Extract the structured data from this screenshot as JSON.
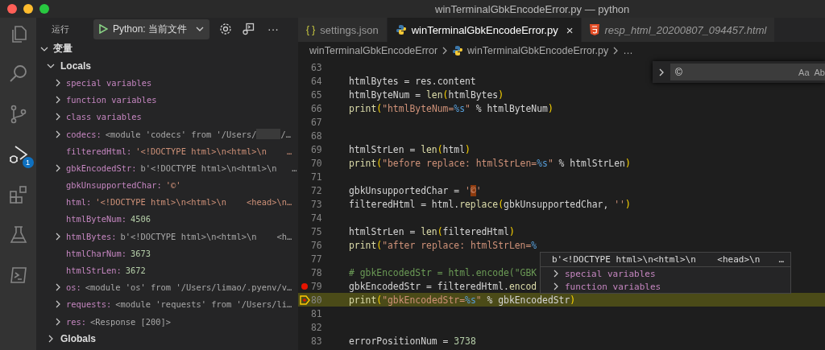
{
  "window": {
    "title": "winTerminalGbkEncodeError.py — python"
  },
  "activity_bar": [
    {
      "kind": "files",
      "selected": false
    },
    {
      "kind": "search",
      "selected": false
    },
    {
      "kind": "source-control",
      "selected": false
    },
    {
      "kind": "debug",
      "selected": true,
      "badge": "1"
    },
    {
      "kind": "extensions",
      "selected": false
    },
    {
      "kind": "testing",
      "selected": false
    },
    {
      "kind": "remote",
      "selected": false
    }
  ],
  "sidebar": {
    "title": "运行",
    "launch_config": "Python: 当前文件",
    "more": "···",
    "variables": {
      "label": "变量",
      "expanded": true,
      "scopes": [
        {
          "label": "Locals",
          "expanded": true,
          "items": [
            {
              "name": "special variables",
              "expandable": true
            },
            {
              "name": "function variables",
              "expandable": true
            },
            {
              "name": "class variables",
              "expandable": true
            },
            {
              "name": "codecs:",
              "value": "<module 'codecs' from '/Users/",
              "kind": "obj",
              "redacted": true,
              "value_tail": "/…",
              "expandable": true
            },
            {
              "name": "filteredHtml:",
              "value": "'<!DOCTYPE html>\\n<html>\\n    …",
              "kind": "str",
              "expandable": false
            },
            {
              "name": "gbkEncodedStr:",
              "value": "b'<!DOCTYPE html>\\n<html>\\n   …",
              "kind": "obj",
              "expandable": true
            },
            {
              "name": "gbkUnsupportedChar:",
              "value": "'©'",
              "kind": "str",
              "expandable": false
            },
            {
              "name": "html:",
              "value": "'<!DOCTYPE html>\\n<html>\\n    <head>\\n…",
              "kind": "str",
              "expandable": false
            },
            {
              "name": "htmlByteNum:",
              "value": "4506",
              "kind": "num",
              "expandable": false
            },
            {
              "name": "htmlBytes:",
              "value": "b'<!DOCTYPE html>\\n<html>\\n    <h…",
              "kind": "obj",
              "expandable": true
            },
            {
              "name": "htmlCharNum:",
              "value": "3673",
              "kind": "num",
              "expandable": false
            },
            {
              "name": "htmlStrLen:",
              "value": "3672",
              "kind": "num",
              "expandable": false
            },
            {
              "name": "os:",
              "value": "<module 'os' from '/Users/limao/.pyenv/v…",
              "kind": "obj",
              "expandable": true
            },
            {
              "name": "requests:",
              "value": "<module 'requests' from '/Users/li…",
              "kind": "obj",
              "expandable": true
            },
            {
              "name": "res:",
              "value": "<Response [200]>",
              "kind": "obj",
              "expandable": true
            }
          ]
        },
        {
          "label": "Globals",
          "expanded": false
        }
      ]
    }
  },
  "tabs": [
    {
      "label": "settings.json",
      "kind": "json",
      "icon_text": "{ }",
      "selected": false,
      "preview": false
    },
    {
      "label": "winTerminalGbkEncodeError.py",
      "kind": "python",
      "selected": true,
      "preview": false,
      "close": "×"
    },
    {
      "label": "resp_html_20200807_094457.html",
      "kind": "html",
      "selected": false,
      "preview": true
    }
  ],
  "breadcrumbs": [
    {
      "label": "winTerminalGbkEncodeError",
      "kind": "folder"
    },
    {
      "label": "winTerminalGbkEncodeError.py",
      "kind": "python"
    },
    {
      "label": "…",
      "kind": "more"
    }
  ],
  "find_widget": {
    "value": "©",
    "options": [
      "Aa",
      "Ab"
    ]
  },
  "code": [
    {
      "number": "63"
    },
    {
      "number": "64",
      "tokens": [
        {
          "text": "htmlBytes = res.content",
          "kind": "plain"
        }
      ]
    },
    {
      "number": "65",
      "tokens": [
        {
          "text": "htmlByteNum = ",
          "kind": "plain"
        },
        {
          "text": "len",
          "kind": "function"
        },
        {
          "text": "(",
          "kind": "paren"
        },
        {
          "text": "htmlBytes",
          "kind": "plain"
        },
        {
          "text": ")",
          "kind": "paren"
        }
      ]
    },
    {
      "number": "66",
      "tokens": [
        {
          "text": "print",
          "kind": "function"
        },
        {
          "text": "(",
          "kind": "paren"
        },
        {
          "text": "\"htmlByteNum=",
          "kind": "string"
        },
        {
          "text": "%s",
          "kind": "format"
        },
        {
          "text": "\"",
          "kind": "string"
        },
        {
          "text": " % htmlByteNum",
          "kind": "plain"
        },
        {
          "text": ")",
          "kind": "paren"
        }
      ]
    },
    {
      "number": "67"
    },
    {
      "number": "68"
    },
    {
      "number": "69",
      "tokens": [
        {
          "text": "htmlStrLen = ",
          "kind": "plain"
        },
        {
          "text": "len",
          "kind": "function"
        },
        {
          "text": "(",
          "kind": "paren"
        },
        {
          "text": "html",
          "kind": "plain"
        },
        {
          "text": ")",
          "kind": "paren"
        }
      ]
    },
    {
      "number": "70",
      "tokens": [
        {
          "text": "print",
          "kind": "function"
        },
        {
          "text": "(",
          "kind": "paren"
        },
        {
          "text": "\"before replace: htmlStrLen=",
          "kind": "string"
        },
        {
          "text": "%s",
          "kind": "format"
        },
        {
          "text": "\"",
          "kind": "string"
        },
        {
          "text": " % htmlStrLen",
          "kind": "plain"
        },
        {
          "text": ")",
          "kind": "paren"
        }
      ]
    },
    {
      "number": "71"
    },
    {
      "number": "72",
      "tokens": [
        {
          "text": "gbkUnsupportedChar = ",
          "kind": "plain"
        },
        {
          "text": "'",
          "kind": "string"
        },
        {
          "text": "©",
          "kind": "match"
        },
        {
          "text": "'",
          "kind": "string"
        }
      ]
    },
    {
      "number": "73",
      "tokens": [
        {
          "text": "filteredHtml = html.",
          "kind": "plain"
        },
        {
          "text": "replace",
          "kind": "function"
        },
        {
          "text": "(",
          "kind": "paren"
        },
        {
          "text": "gbkUnsupportedChar, ",
          "kind": "plain"
        },
        {
          "text": "''",
          "kind": "string"
        },
        {
          "text": ")",
          "kind": "paren"
        }
      ]
    },
    {
      "number": "74"
    },
    {
      "number": "75",
      "tokens": [
        {
          "text": "htmlStrLen = ",
          "kind": "plain"
        },
        {
          "text": "len",
          "kind": "function"
        },
        {
          "text": "(",
          "kind": "paren"
        },
        {
          "text": "filteredHtml",
          "kind": "plain"
        },
        {
          "text": ")",
          "kind": "paren"
        }
      ]
    },
    {
      "number": "76",
      "tokens": [
        {
          "text": "print",
          "kind": "function"
        },
        {
          "text": "(",
          "kind": "paren"
        },
        {
          "text": "\"after replace: htmlStrLen=",
          "kind": "string"
        },
        {
          "text": "%",
          "kind": "format"
        }
      ]
    },
    {
      "number": "77"
    },
    {
      "number": "78",
      "tokens": [
        {
          "text": "# gbkEncodedStr = html.encode(\"GBK",
          "kind": "comment"
        }
      ]
    },
    {
      "number": "79",
      "breakpoint": true,
      "tokens": [
        {
          "text": "gbkEncodedStr = filteredHtml.",
          "kind": "plain"
        },
        {
          "text": "encod",
          "kind": "function"
        }
      ]
    },
    {
      "number": "80",
      "current": true,
      "tokens": [
        {
          "text": "print",
          "kind": "function"
        },
        {
          "text": "(",
          "kind": "paren"
        },
        {
          "text": "\"gbkEncodedStr=",
          "kind": "string"
        },
        {
          "text": "%s",
          "kind": "format"
        },
        {
          "text": "\"",
          "kind": "string"
        },
        {
          "text": " % gbkEncodedStr",
          "kind": "plain"
        },
        {
          "text": ")",
          "kind": "paren"
        }
      ]
    },
    {
      "number": "81"
    },
    {
      "number": "82"
    },
    {
      "number": "83",
      "tokens": [
        {
          "text": "errorPositionNum = ",
          "kind": "plain"
        },
        {
          "text": "3738",
          "kind": "number"
        }
      ]
    }
  ],
  "hover": {
    "value": "b'<!DOCTYPE html>\\n<html>\\n    <head>\\n",
    "more": "…",
    "items": [
      {
        "name": "special variables",
        "expanded": false
      },
      {
        "name": "function variables",
        "expanded": false
      }
    ]
  }
}
